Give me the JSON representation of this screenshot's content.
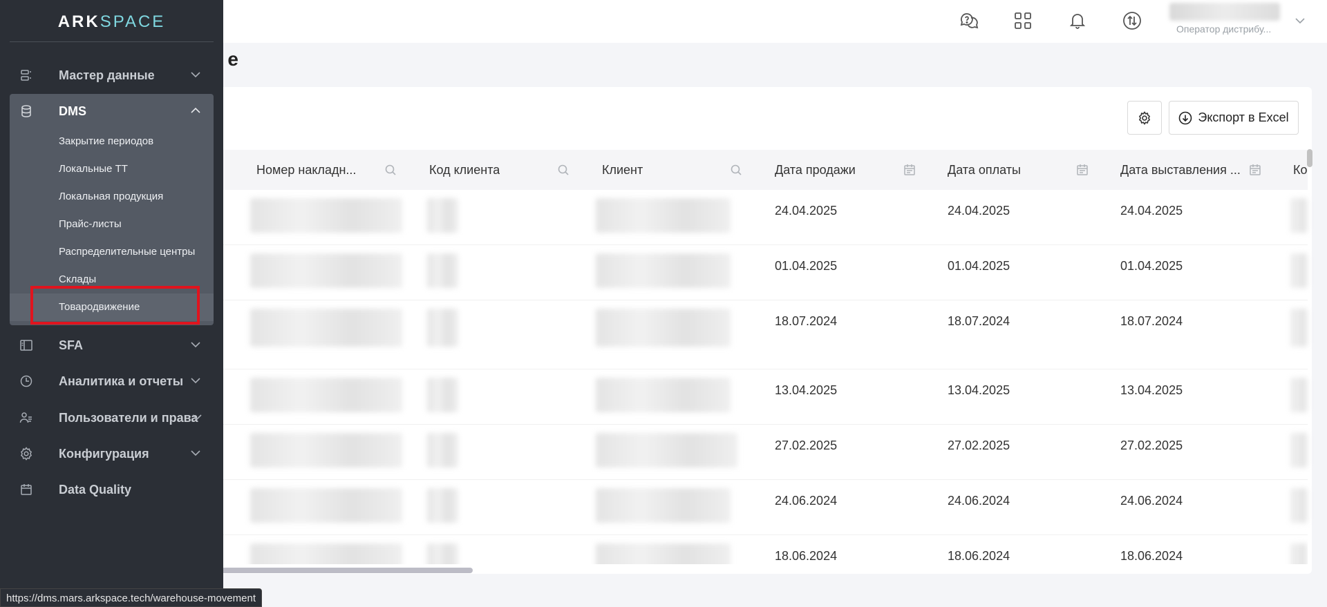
{
  "app": {
    "logo_left": "ARK",
    "logo_right": "SPACE"
  },
  "header": {
    "icons": [
      "help-chat-icon",
      "apps-grid-icon",
      "bell-icon",
      "sync-icon"
    ],
    "user_role": "Оператор дистрибу..."
  },
  "page": {
    "title_fragment": "е"
  },
  "sidebar": {
    "items": [
      {
        "label": "Мастер данные",
        "icon": "master-data-icon"
      },
      {
        "label": "DMS",
        "icon": "database-icon"
      },
      {
        "label": "SFA",
        "icon": "sfa-panel-icon"
      },
      {
        "label": "Аналитика и отчеты",
        "icon": "clock-chart-icon"
      },
      {
        "label": "Пользователи и права",
        "icon": "users-icon"
      },
      {
        "label": "Конфигурация",
        "icon": "gear-icon"
      },
      {
        "label": "Data Quality",
        "icon": "calendar-icon"
      }
    ],
    "dms_subitems": [
      "Закрытие периодов",
      "Локальные ТТ",
      "Локальная продукция",
      "Прайс-листы",
      "Распределительные центры",
      "Склады",
      "Товародвижение"
    ]
  },
  "toolbar": {
    "export_label": "Экспорт в Excel"
  },
  "table": {
    "columns": [
      {
        "label": "Номер накладн...",
        "filter": "search"
      },
      {
        "label": "Код клиента",
        "filter": "search"
      },
      {
        "label": "Клиент",
        "filter": "search"
      },
      {
        "label": "Дата продажи",
        "filter": "calendar"
      },
      {
        "label": "Дата оплаты",
        "filter": "calendar"
      },
      {
        "label": "Дата выставления ...",
        "filter": "calendar"
      },
      {
        "label": "Ко",
        "filter": ""
      }
    ],
    "rows": [
      {
        "sale_date": "24.04.2025",
        "pay_date": "24.04.2025",
        "issue_date": "24.04.2025"
      },
      {
        "sale_date": "01.04.2025",
        "pay_date": "01.04.2025",
        "issue_date": "01.04.2025"
      },
      {
        "sale_date": "18.07.2024",
        "pay_date": "18.07.2024",
        "issue_date": "18.07.2024"
      },
      {
        "sale_date": "13.04.2025",
        "pay_date": "13.04.2025",
        "issue_date": "13.04.2025"
      },
      {
        "sale_date": "27.02.2025",
        "pay_date": "27.02.2025",
        "issue_date": "27.02.2025"
      },
      {
        "sale_date": "24.06.2024",
        "pay_date": "24.06.2024",
        "issue_date": "24.06.2024"
      },
      {
        "sale_date": "18.06.2024",
        "pay_date": "18.06.2024",
        "issue_date": "18.06.2024"
      }
    ]
  },
  "status_bar": {
    "url": "https://dms.mars.arkspace.tech/warehouse-movement"
  }
}
